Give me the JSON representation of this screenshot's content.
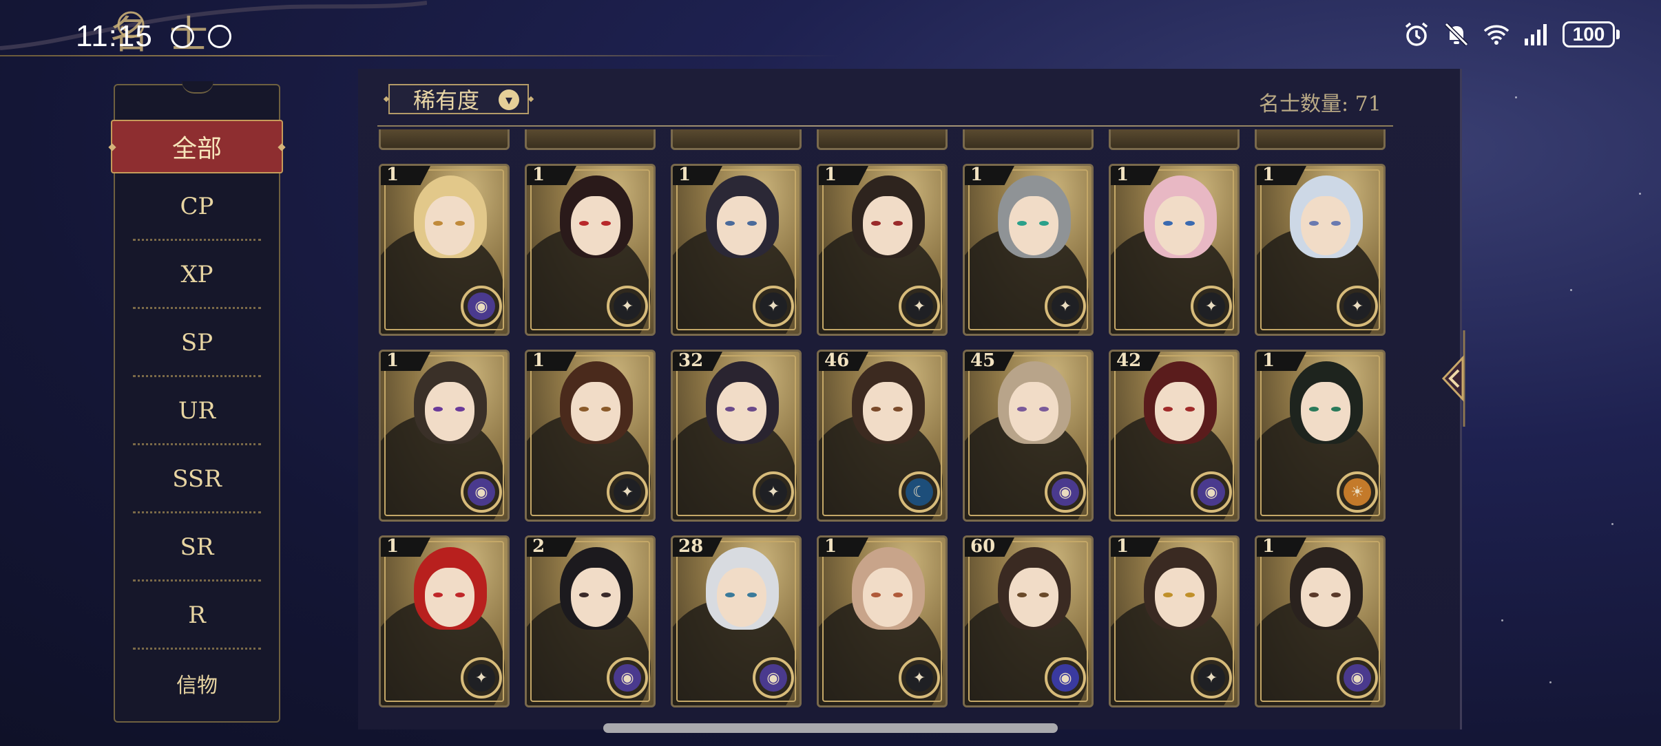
{
  "status_bar": {
    "time": "11:15",
    "battery": "100",
    "icons": [
      "alarm-icon",
      "mute-icon",
      "wifi-icon",
      "signal-icon",
      "battery-icon"
    ]
  },
  "header": {
    "title": "名士"
  },
  "sidebar": {
    "items": [
      {
        "label": "全部",
        "active": true
      },
      {
        "label": "CP"
      },
      {
        "label": "XP"
      },
      {
        "label": "SP"
      },
      {
        "label": "UR"
      },
      {
        "label": "SSR"
      },
      {
        "label": "SR"
      },
      {
        "label": "R"
      },
      {
        "label": "信物"
      }
    ]
  },
  "filter": {
    "label": "稀有度"
  },
  "count": {
    "label": "名士数量: 71"
  },
  "colors": {
    "accent_red": "#8e2e30",
    "gold": "#d7bb7a",
    "panel": "#1a1a35"
  },
  "cards": [
    {
      "level": "1",
      "hair": "#e2c88a",
      "eyes": "#c08a3a",
      "badge": "#4a3a8e",
      "badge_icon": "planet"
    },
    {
      "level": "1",
      "hair": "#2a1a1a",
      "eyes": "#b8282a",
      "badge": "#1f2024",
      "badge_icon": "compass"
    },
    {
      "level": "1",
      "hair": "#2b2836",
      "eyes": "#4a6a9a",
      "badge": "#1f2024",
      "badge_icon": "compass"
    },
    {
      "level": "1",
      "hair": "#2e241e",
      "eyes": "#9a2a2a",
      "badge": "#1f2024",
      "badge_icon": "compass"
    },
    {
      "level": "1",
      "hair": "#8f9396",
      "eyes": "#2aa08a",
      "badge": "#1f2024",
      "badge_icon": "compass"
    },
    {
      "level": "1",
      "hair": "#e8b8c4",
      "eyes": "#3a6ab0",
      "badge": "#1f2024",
      "badge_icon": "compass"
    },
    {
      "level": "1",
      "hair": "#cdd8e6",
      "eyes": "#6a7ab0",
      "badge": "#1f2024",
      "badge_icon": "compass"
    },
    {
      "level": "1",
      "hair": "#3a3028",
      "eyes": "#6a3a9a",
      "badge": "#4a3a8e",
      "badge_icon": "planet"
    },
    {
      "level": "1",
      "hair": "#4a2a1c",
      "eyes": "#8a5a2a",
      "badge": "#1f2024",
      "badge_icon": "compass"
    },
    {
      "level": "32",
      "hair": "#2a2430",
      "eyes": "#6a4a8a",
      "badge": "#1f2024",
      "badge_icon": "compass"
    },
    {
      "level": "46",
      "hair": "#3c2a20",
      "eyes": "#7a4a2a",
      "badge": "#1d4e7a",
      "badge_icon": "moon"
    },
    {
      "level": "45",
      "hair": "#b8a48a",
      "eyes": "#7a5a9a",
      "badge": "#4a3a8e",
      "badge_icon": "planet"
    },
    {
      "level": "42",
      "hair": "#5a1c1c",
      "eyes": "#a02a2a",
      "badge": "#4a3a8e",
      "badge_icon": "planet"
    },
    {
      "level": "1",
      "hair": "#1e241e",
      "eyes": "#2a7a5a",
      "badge": "#c47a2a",
      "badge_icon": "sun"
    },
    {
      "level": "1",
      "hair": "#b8201e",
      "eyes": "#c0282a",
      "badge": "#1f2024",
      "badge_icon": "compass"
    },
    {
      "level": "2",
      "hair": "#1c1a1e",
      "eyes": "#3a2a2a",
      "badge": "#4a3a8e",
      "badge_icon": "planet"
    },
    {
      "level": "28",
      "hair": "#d8dbe0",
      "eyes": "#3a7a9a",
      "badge": "#4a3a8e",
      "badge_icon": "planet"
    },
    {
      "level": "1",
      "hair": "#c8a48a",
      "eyes": "#b05a3a",
      "badge": "#1f2024",
      "badge_icon": "compass"
    },
    {
      "level": "60",
      "hair": "#3a2a22",
      "eyes": "#6a4a2a",
      "badge": "#3a3aa0",
      "badge_icon": "planet"
    },
    {
      "level": "1",
      "hair": "#3a2a22",
      "eyes": "#c0902a",
      "badge": "#1f2024",
      "badge_icon": "compass"
    },
    {
      "level": "1",
      "hair": "#2a221e",
      "eyes": "#5a3a2a",
      "badge": "#4a3a8e",
      "badge_icon": "planet"
    }
  ]
}
